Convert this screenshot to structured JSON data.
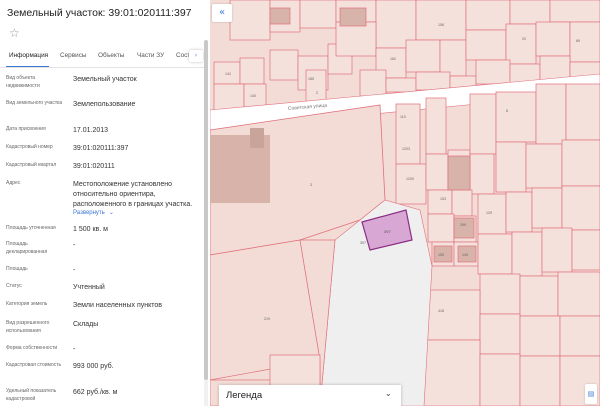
{
  "panel": {
    "title": "Земельный участок: 39:01:020111:397",
    "favorite_icon": "star-icon",
    "tabs": [
      {
        "label": "Информация",
        "active": true
      },
      {
        "label": "Сервисы",
        "active": false
      },
      {
        "label": "Объекты",
        "active": false
      },
      {
        "label": "Части ЗУ",
        "active": false
      },
      {
        "label": "Сост",
        "active": false
      }
    ],
    "tabs_more_icon": "chevron-right-icon",
    "rows": [
      {
        "key": "Вид объекта недвижимости",
        "value": "Земельный участок"
      },
      {
        "key": "Вид земельного участка",
        "value": "Землепользование"
      },
      {
        "key": "Дата присвоения",
        "value": "17.01.2013"
      },
      {
        "key": "Кадастровый номер",
        "value": "39:01:020111:397"
      },
      {
        "key": "Кадастровый квартал",
        "value": "39:01:020111"
      },
      {
        "key": "Адрес",
        "value": "Местоположение установлено относительно ориентира, расположенного в границах участка."
      },
      {
        "key": "Площадь уточненная",
        "value": "1 500 кв. м"
      },
      {
        "key": "Площадь декларированная",
        "value": "-"
      },
      {
        "key": "Площадь",
        "value": "-"
      },
      {
        "key": "Статус",
        "value": "Учтенный"
      },
      {
        "key": "Категория земель",
        "value": "Земли населенных пунктов"
      },
      {
        "key": "Вид разрешенного использования",
        "value": "Склады"
      },
      {
        "key": "Форма собственности",
        "value": "-"
      },
      {
        "key": "Кадастровая стоимость",
        "value": "993 000 руб."
      },
      {
        "key": "Удельный показатель кадастровой",
        "value": "662 руб./кв. м"
      }
    ],
    "expand_label": "Развернуть"
  },
  "map": {
    "collapse_icon": "double-chevron-left-icon",
    "street_label": "Советская улица",
    "selected_parcel_label": "397",
    "colors": {
      "background": "#f3dcd6",
      "parcel_border": "#e0707a",
      "selected_fill": "#d9a7d3",
      "selected_border": "#8b2e86",
      "street": "#ffffff",
      "building": "#d8b3aa"
    },
    "parcel_numbers": [
      "141",
      "185",
      "140",
      "162",
      "3",
      "156",
      "20",
      "89",
      "397",
      "2",
      "219",
      "153",
      "399",
      "155",
      "149",
      "129",
      "110",
      "1203",
      "1200",
      "418",
      "8"
    ],
    "legend": {
      "label": "Легенда",
      "icon": "chevron-down-icon"
    },
    "corner_icon": "layers-icon"
  }
}
